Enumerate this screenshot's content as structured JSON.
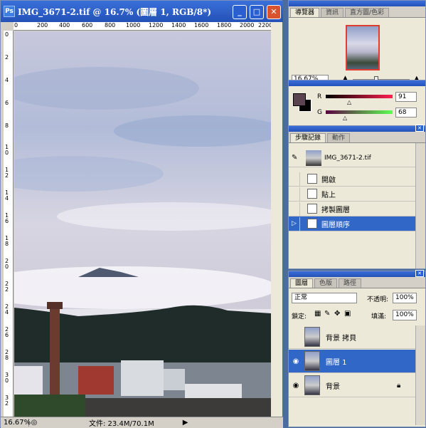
{
  "document": {
    "title": "IMG_3671-2.tif @ 16.7% (圖層 1, RGB/8*)",
    "ruler_h_labels": [
      "0",
      "200",
      "400",
      "600",
      "800",
      "1000",
      "1200",
      "1400",
      "1600",
      "1800",
      "2000",
      "2200"
    ],
    "ruler_v_labels": [
      "0",
      "2",
      "4",
      "6",
      "8",
      "1 0",
      "1 2",
      "1 4",
      "1 6",
      "1 8",
      "2 0",
      "2 2",
      "2 4",
      "2 6",
      "2 8",
      "3 0",
      "3 2"
    ],
    "status": {
      "zoom": "16.67%",
      "file": "文件: 23.4M/70.1M"
    }
  },
  "navigator": {
    "tabs": [
      "導覽器",
      "資訊",
      "直方圖/色彩"
    ],
    "zoom": "16.67%"
  },
  "color_panel": {
    "r_label": "R",
    "r_value": "91",
    "g_label": "G",
    "g_value": "68",
    "fg_color": "#5b4450",
    "bg_color": "#000000"
  },
  "history": {
    "tabs": [
      "步驟記錄",
      "動作"
    ],
    "snapshot": "IMG_3671-2.tif",
    "items": [
      "開啟",
      "貼上",
      "拷製圖層",
      "圖層順序"
    ]
  },
  "layers": {
    "tabs": [
      "圖層",
      "色版",
      "路徑"
    ],
    "blend_mode": "正常",
    "opacity_label": "不透明:",
    "opacity_value": "100%",
    "lock_label": "鎖定:",
    "fill_label": "填滿:",
    "fill_value": "100%",
    "items": [
      "背景 拷貝",
      "圖層 1",
      "背景"
    ]
  },
  "accent": {
    "titlebar": "#2452b8",
    "selection": "#3168c8",
    "close": "#d9532e"
  }
}
